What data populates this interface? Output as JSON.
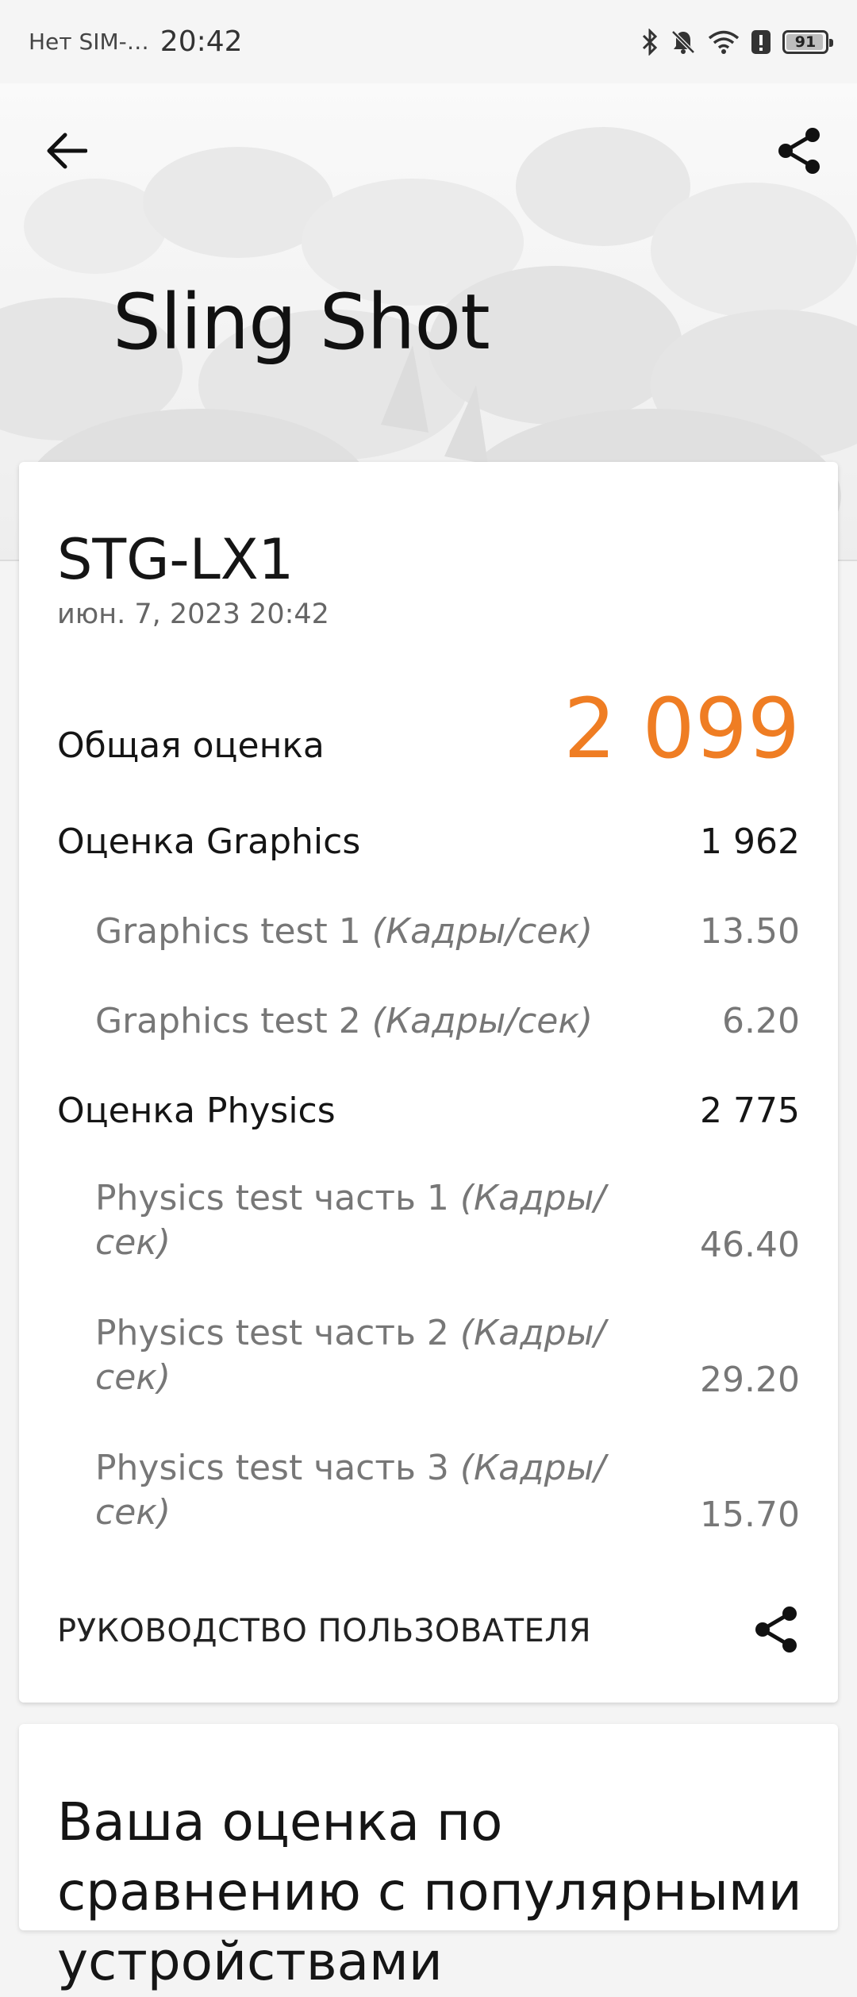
{
  "status_bar": {
    "carrier": "Нет SIM-…",
    "time": "20:42",
    "battery": "91"
  },
  "header": {
    "title": "Sling Shot",
    "back_icon": "arrow-left-icon",
    "share_icon": "share-icon"
  },
  "result": {
    "device": "STG-LX1",
    "date": "июн. 7, 2023 20:42",
    "overall_label": "Общая оценка",
    "overall_score": "2 099",
    "accent_color": "#ef7d23",
    "graphics_label": "Оценка Graphics",
    "graphics_score": "1 962",
    "graphics_tests": [
      {
        "name": "Graphics test 1",
        "unit": "(Кадры/сек)",
        "value": "13.50"
      },
      {
        "name": "Graphics test 2",
        "unit": "(Кадры/сек)",
        "value": "6.20"
      }
    ],
    "physics_label": "Оценка Physics",
    "physics_score": "2 775",
    "physics_tests": [
      {
        "name": "Physics test часть 1",
        "unit": "(Кадры/сек)",
        "value": "46.40"
      },
      {
        "name": "Physics test часть 2",
        "unit": "(Кадры/сек)",
        "value": "29.20"
      },
      {
        "name": "Physics test часть 3",
        "unit": "(Кадры/сек)",
        "value": "15.70"
      }
    ],
    "guide_label": "РУКОВОДСТВО ПОЛЬЗОВАТЕЛЯ"
  },
  "comparison": {
    "title": "Ваша оценка по сравнению с популярными устройствами"
  }
}
